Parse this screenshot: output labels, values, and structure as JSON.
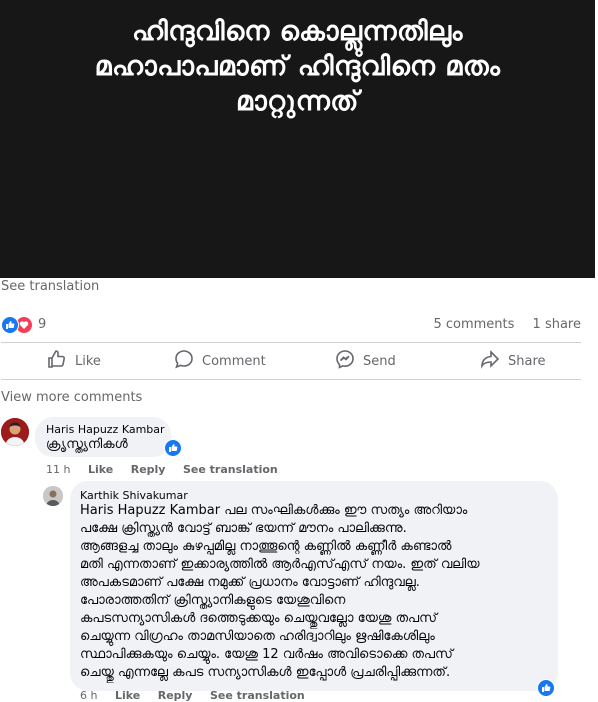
{
  "post": {
    "image_text": "ഹിന്ദുവിനെ കൊല്ലുന്നതിലും\nമഹാപാപമാണ് ഹിന്ദുവിനെ മതം\nമാറ്റുന്നത്",
    "see_translation": "See translation",
    "reaction_count": "9",
    "comments_count": "5 comments",
    "shares_count": "1 share",
    "reaction_icons": [
      "like-icon",
      "love-icon"
    ]
  },
  "actions": {
    "like": "Like",
    "comment": "Comment",
    "send": "Send",
    "share": "Share"
  },
  "view_more": "View more comments",
  "comments": [
    {
      "author": "Haris Hapuzz Kambar",
      "text": "ക്രൃസ്ത്യനികൾ",
      "time": "11 h",
      "like": "Like",
      "reply": "Reply",
      "translate": "See translation"
    },
    {
      "author": "Karthik Shivakumar",
      "mention": "Haris Hapuzz Kambar",
      "text": " പല സംഘികൾക്കും ഈ സത്യം അറിയാം\nപക്ഷേ ക്രിസ്ത്യൻ വോട്ട് ബാങ്ക് ഭയന്ന് മൗനം പാലിക്കുന്നു.\nആങ്ങളച്ച താലും കുഴപ്പമില്ല നാത്തൂന്റെ കണ്ണിൽ കണ്ണീർ കണ്ടാൽ\nമതി എന്നതാണ് ഇക്കാര്യത്തിൽ ആർഎസ്എസ് നയം. ഇത് വലിയ\nഅപകടമാണ് പക്ഷേ നമുക്ക് പ്രധാനം വോട്ടാണ് ഹിന്ദുവല്ല.\nപോരാത്തതിന് ക്രിസ്ത്യാനികളുടെ യേശുവിനെ\nകപടസന്യാസികൾ ദത്തെടുക്കയും ചെയ്തുവല്ലോ യേശു തപസ്\nചെയ്യുന്ന വിഗ്രഹം താമസിയാതെ ഹരിദ്വാറിലും ഋഷികേശിലും\nസ്ഥാപിക്കുകയും ചെയ്യും. യേശു 12 വർഷം അവിടൊക്കെ തപസ്\nചെയ്തു എന്നല്ലേ കപട സന്യാസികൾ ഇപ്പോൾ പ്രചരിപ്പിക്കുന്നത്.",
      "time": "6 h",
      "like": "Like",
      "reply": "Reply",
      "translate": "See translation"
    }
  ],
  "colors": {
    "facebook_blue": "#1877f2",
    "love_red": "#f33e58",
    "muted_text": "#65676b",
    "bubble_bg": "#f0f2f5",
    "image_bg": "#171717"
  }
}
